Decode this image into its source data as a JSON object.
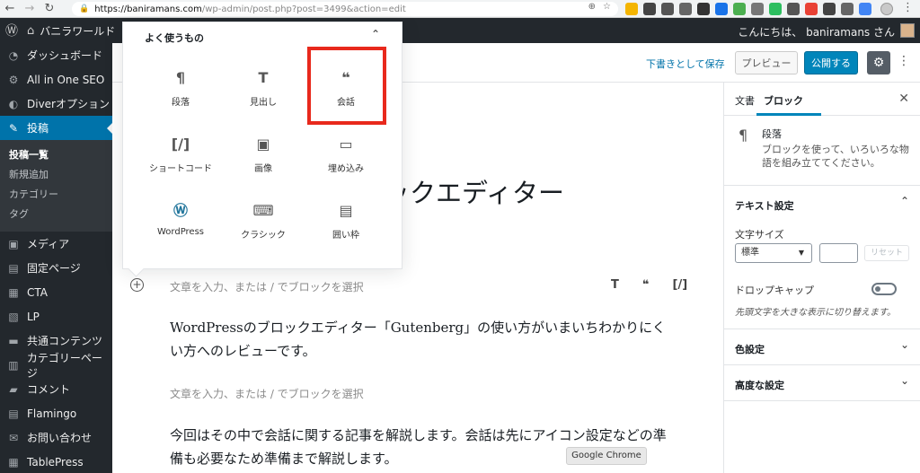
{
  "browser": {
    "url_host": "https://baniramans.com",
    "url_path": "/wp-admin/post.php?post=3499&action=edit",
    "tooltip": "Google Chrome"
  },
  "adminbar": {
    "site_name": "バニラワールド",
    "howdy": "こんにちは、 baniramans さん"
  },
  "sidebar": {
    "items": [
      {
        "label": "ダッシュボード",
        "icon": "dashboard-icon"
      },
      {
        "label": "All in One SEO",
        "icon": "seo-icon"
      },
      {
        "label": "Diverオプション",
        "icon": "diver-icon"
      },
      {
        "label": "投稿",
        "icon": "pin-icon"
      }
    ],
    "submenu": [
      "投稿一覧",
      "新規追加",
      "カテゴリー",
      "タグ"
    ],
    "items2": [
      {
        "label": "メディア",
        "icon": "media-icon"
      },
      {
        "label": "固定ページ",
        "icon": "page-icon"
      },
      {
        "label": "CTA",
        "icon": "cta-icon"
      },
      {
        "label": "LP",
        "icon": "lp-icon"
      },
      {
        "label": "共通コンテンツ",
        "icon": "folder-icon"
      },
      {
        "label": "カテゴリーページ",
        "icon": "grid-icon"
      },
      {
        "label": "コメント",
        "icon": "comment-icon"
      },
      {
        "label": "Flamingo",
        "icon": "flamingo-icon"
      },
      {
        "label": "お問い合わせ",
        "icon": "mail-icon"
      },
      {
        "label": "TablePress",
        "icon": "table-icon"
      }
    ]
  },
  "toolbar": {
    "save_draft": "下書きとして保存",
    "preview": "プレビュー",
    "publish": "公開する"
  },
  "inserter": {
    "heading": "よく使うもの",
    "blocks": [
      {
        "label": "段落",
        "glyph": "¶"
      },
      {
        "label": "見出し",
        "glyph": "T"
      },
      {
        "label": "会話",
        "glyph": "❝"
      },
      {
        "label": "ショートコード",
        "glyph": "[/]"
      },
      {
        "label": "画像",
        "glyph": "▣"
      },
      {
        "label": "埋め込み",
        "glyph": "▭"
      },
      {
        "label": "WordPress",
        "glyph": "Ⓦ"
      },
      {
        "label": "クラシック",
        "glyph": "⌨"
      },
      {
        "label": "囲い枠",
        "glyph": "▤"
      }
    ]
  },
  "editor": {
    "title_visible": "ックエディター",
    "placeholder": "文章を入力、または / でブロックを選択",
    "quick_insert": [
      "T",
      "❝",
      "[/]"
    ],
    "para1": "WordPressのブロックエディター「Gutenberg」の使い方がいまいちわかりにくい方へのレビューです。",
    "para2": "今回はその中で会話に関する記事を解説します。会話は先にアイコン設定などの準備も必要なため準備まで解説します。"
  },
  "settings": {
    "tab_document": "文書",
    "tab_block": "ブロック",
    "block_name": "段落",
    "block_desc": "ブロックを使って、いろいろな物語を組み立ててください。",
    "text_settings": "テキスト設定",
    "font_size_label": "文字サイズ",
    "font_size_value": "標準",
    "reset": "リセット",
    "drop_cap": "ドロップキャップ",
    "drop_cap_help": "先頭文字を大きな表示に切り替えます。",
    "color_settings": "色設定",
    "advanced": "高度な設定"
  }
}
